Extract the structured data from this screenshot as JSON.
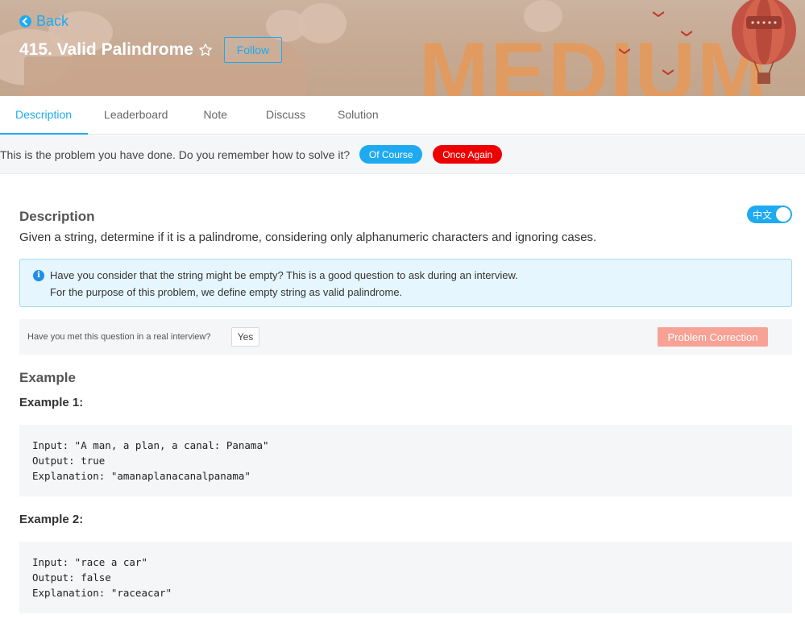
{
  "header": {
    "back_label": "Back",
    "title": "415. Valid Palindrome",
    "follow_label": "Follow",
    "difficulty_banner": "MEDIUM"
  },
  "tabs": [
    {
      "label": "Description",
      "active": true
    },
    {
      "label": "Leaderboard",
      "active": false
    },
    {
      "label": "Note",
      "active": false
    },
    {
      "label": "Discuss",
      "active": false
    },
    {
      "label": "Solution",
      "active": false
    }
  ],
  "prompt": {
    "text": "This is the problem you have done. Do you remember how to solve it?",
    "of_course_label": "Of Course",
    "once_again_label": "Once Again"
  },
  "description": {
    "heading": "Description",
    "language_toggle": "中文",
    "text": "Given a string, determine if it is a palindrome, considering only alphanumeric characters and ignoring cases.",
    "info_line_1": "Have you consider that the string might be empty? This is a good question to ask during an interview.",
    "info_line_2": "For the purpose of this problem, we define empty string as valid palindrome."
  },
  "interview": {
    "question": "Have you met this question in a real interview?",
    "yes_label": "Yes",
    "correction_label": "Problem Correction"
  },
  "example": {
    "heading": "Example",
    "examples": [
      {
        "title": "Example 1:",
        "input": "Input: \"A man, a plan, a canal: Panama\"",
        "output": "Output: true",
        "explanation": "Explanation: \"amanaplanacanalpanama\""
      },
      {
        "title": "Example 2:",
        "input": "Input: \"race a car\"",
        "output": "Output: false",
        "explanation": "Explanation: \"raceacar\""
      }
    ]
  },
  "colors": {
    "accent": "#1eaaf1",
    "danger": "#ee0000",
    "correction": "#f8a195",
    "banner_text": "#e49a5c"
  }
}
